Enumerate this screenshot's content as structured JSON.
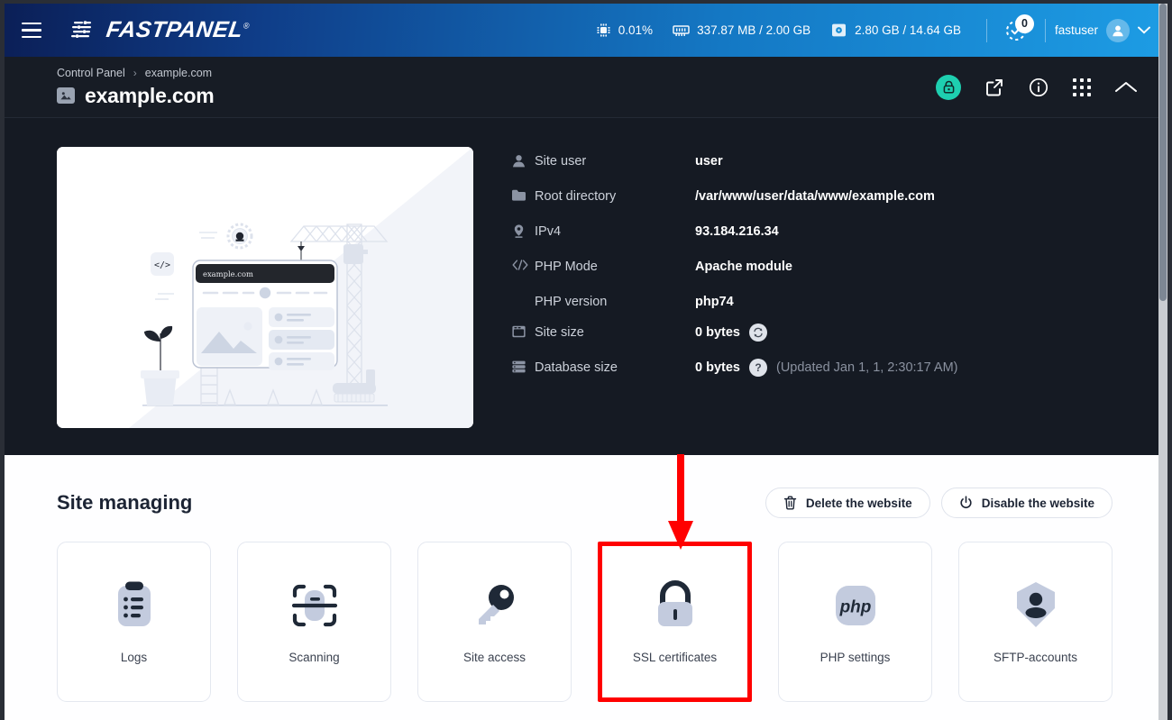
{
  "topbar": {
    "brand": "FASTPANEL",
    "brand_reg": "®",
    "menu_label": "menu",
    "stats": [
      {
        "icon": "cpu-icon",
        "value": "0.01%"
      },
      {
        "icon": "ram-icon",
        "value": "337.87 MB / 2.00 GB"
      },
      {
        "icon": "disk-icon",
        "value": "2.80 GB / 14.64 GB"
      }
    ],
    "tasks_badge": "0",
    "username": "fastuser"
  },
  "header": {
    "breadcrumb": {
      "root": "Control Panel",
      "separator": "›",
      "current": "example.com"
    },
    "title": "example.com",
    "actions": [
      {
        "name": "ssl-lock-button",
        "icon": "lock-icon"
      },
      {
        "name": "open-site-button",
        "icon": "external-link-icon"
      },
      {
        "name": "info-button",
        "icon": "info-circle-icon"
      },
      {
        "name": "apps-button",
        "icon": "grid-apps-icon"
      },
      {
        "name": "collapse-button",
        "icon": "chevron-up-icon"
      }
    ]
  },
  "illustration": {
    "browser_url": "example.com"
  },
  "info": {
    "rows": [
      {
        "icon": "user-icon",
        "label": "Site user",
        "value": "user"
      },
      {
        "icon": "folder-icon",
        "label": "Root directory",
        "value": "/var/www/user/data/www/example.com"
      },
      {
        "icon": "location-icon",
        "label": "IPv4",
        "value": "93.184.216.34"
      },
      {
        "icon": "code-icon",
        "label": "PHP Mode",
        "value": "Apache module"
      },
      {
        "icon": "",
        "label": "PHP version",
        "value": "php74"
      },
      {
        "icon": "window-icon",
        "label": "Site size",
        "value": "0 bytes",
        "action": "refresh-icon"
      },
      {
        "icon": "database-icon",
        "label": "Database size",
        "value": "0 bytes",
        "action": "help-icon",
        "note": "(Updated Jan 1, 1, 2:30:17 AM)"
      }
    ]
  },
  "manage": {
    "title": "Site managing",
    "delete_label": "Delete the website",
    "disable_label": "Disable the website",
    "tiles": [
      {
        "label": "Logs",
        "icon": "logs-icon"
      },
      {
        "label": "Scanning",
        "icon": "scan-icon"
      },
      {
        "label": "Site access",
        "icon": "key-icon"
      },
      {
        "label": "SSL certificates",
        "icon": "padlock-icon",
        "highlighted": true
      },
      {
        "label": "PHP settings",
        "icon": "php-icon"
      },
      {
        "label": "SFTP-accounts",
        "icon": "shield-user-icon"
      }
    ]
  },
  "colors": {
    "brand_blue_dark": "#0b1f57",
    "brand_blue_light": "#1d9ce4",
    "page_dark": "#151a23",
    "accent_teal": "#1ecfb0",
    "highlight_red": "#ff0000",
    "icon_light": "#c3cbde",
    "icon_dark": "#1f2937"
  }
}
